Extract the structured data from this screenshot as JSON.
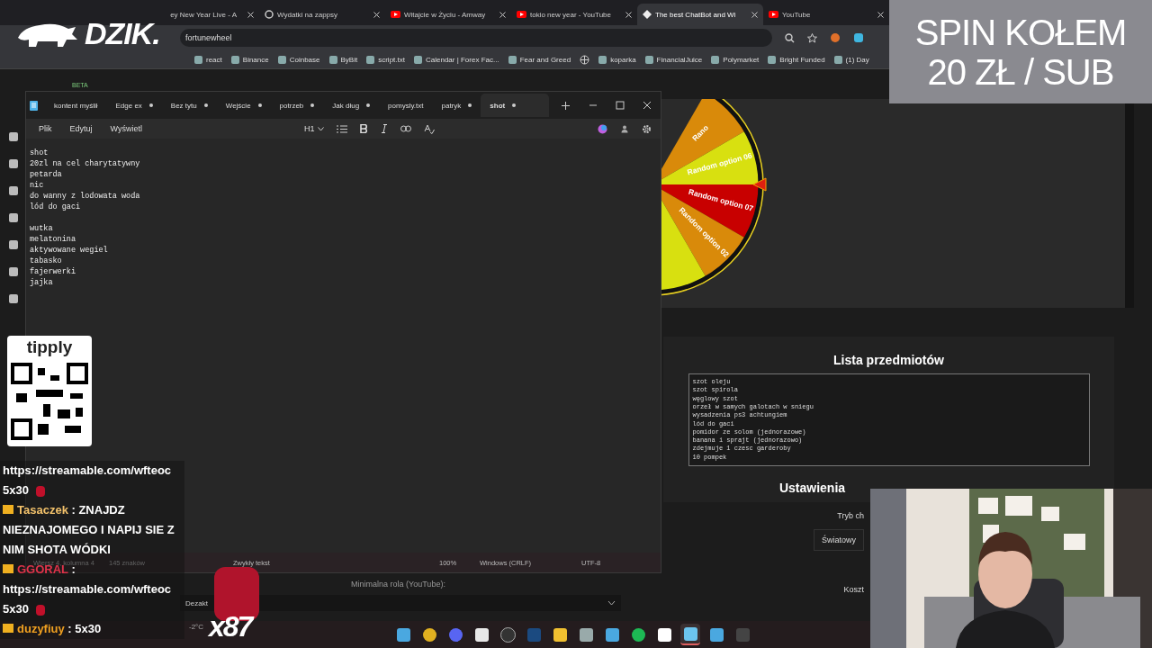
{
  "browser": {
    "tabs": [
      {
        "title": "ey New Year Live - A",
        "selected": false
      },
      {
        "title": "Wydatki na zappsy",
        "kind": "gear",
        "selected": false
      },
      {
        "title": "Witajcie w Życiu - Amway",
        "kind": "video",
        "selected": false
      },
      {
        "title": "tokio new year - YouTube",
        "kind": "video",
        "selected": false
      },
      {
        "title": "The best ChatBot and Wi",
        "kind": "diamond",
        "selected": true
      },
      {
        "title": "YouTube",
        "kind": "video",
        "selected": false
      }
    ],
    "address": "fortunewheel",
    "bookmarks": [
      {
        "label": "react"
      },
      {
        "label": "Binance"
      },
      {
        "label": "Coinbase"
      },
      {
        "label": "ByBit"
      },
      {
        "label": "script.txt"
      },
      {
        "label": "Calendar | Forex Fac..."
      },
      {
        "label": "Fear and Greed"
      },
      {
        "kind": "globe"
      },
      {
        "label": "koparka"
      },
      {
        "label": "FinancialJuice"
      },
      {
        "label": "Polymarket"
      },
      {
        "label": "Bright Funded"
      },
      {
        "label": "(1) Day"
      }
    ]
  },
  "page": {
    "badge": "BETA",
    "wheel": {
      "segments": [
        {
          "label": "Rano",
          "color": "#d98a0a"
        },
        {
          "label": "Random option 06",
          "color": "#d8e010"
        },
        {
          "label": "Random option 07",
          "color": "#c80000"
        },
        {
          "label": "Random option 02",
          "color": "#d98a0a"
        },
        {
          "color": "#d8e010"
        }
      ]
    },
    "items_title": "Lista przedmiotów",
    "items": [
      "szot oleju",
      "szot spirola",
      "węglowy szot",
      "orzeł w samych galotach w sniegu",
      "wysadzenia ps3 achtungiem",
      "lód do gaci",
      "pomidor ze solom (jednorazowe)",
      "banana i sprajt (jednorazowo)",
      "zdejmuje 1 czesc garderoby",
      "10 pompek"
    ],
    "settings_title": "Ustawienia",
    "mode_label": "Tryb ch",
    "mode_value": "Światowy",
    "cost_label": "Koszt",
    "role_label": "Minimalna rola (YouTube):",
    "role_value": "Dezakt"
  },
  "notepad": {
    "tabs": [
      {
        "title": "kontent myślił",
        "modified": false,
        "selected": false
      },
      {
        "title": "Edge ex",
        "modified": true,
        "selected": false
      },
      {
        "title": "Bez tytu",
        "modified": true,
        "selected": false
      },
      {
        "title": "Wejście",
        "modified": true,
        "selected": false
      },
      {
        "title": "potrzeb",
        "modified": true,
        "selected": false
      },
      {
        "title": "Jak dług",
        "modified": true,
        "selected": false
      },
      {
        "title": "pomysly.txt",
        "modified": false,
        "selected": false
      },
      {
        "title": "patryk",
        "modified": true,
        "selected": false
      },
      {
        "title": "shot",
        "modified": true,
        "selected": true
      }
    ],
    "menu": [
      "Plik",
      "Edytuj",
      "Wyświetl"
    ],
    "heading": "H1",
    "blocks": [
      [
        "shot",
        "20zl na cel charytatywny",
        "petarda",
        "nic",
        "do wanny z lodowata woda",
        "lód do gaci"
      ],
      [
        "wutka",
        "melatonina",
        "aktywowane wegiel",
        "tabasko",
        "fajerwerki",
        "jajka"
      ]
    ],
    "status": {
      "position": "Wiersz 4, kolumna 4",
      "chars": "145 znaków",
      "format": "Zwykły tekst",
      "zoom": "100%",
      "eol": "Windows (CRLF)",
      "encoding": "UTF-8"
    }
  },
  "overlay": {
    "logo": "DZIK.",
    "banner": [
      "SPIN KOŁEM",
      "20 ZŁ / SUB"
    ],
    "tip_logo": "tipply",
    "combo": "x87",
    "chat": [
      {
        "text": "https://streamable.com/wfteoc 5x30",
        "gem": true
      },
      {
        "user": "Tasaczek",
        "sep": ":",
        "text": "ZNAJDZ NIEZNAJOMEGO I NAPIJ SIE Z NIM SHOTA WÓDKI",
        "color": "#f3c26b",
        "gem": false
      },
      {
        "user": "GGORAL",
        "sep": ":",
        "text": "https://streamable.com/wfteoc 5x30",
        "color": "#e0334a",
        "gem": true
      },
      {
        "user": "duzyfiuy",
        "sep": ":",
        "text": "5x30",
        "color": "#f0a020",
        "gem": false
      }
    ]
  },
  "taskbar": {
    "weather": "-2°C"
  }
}
